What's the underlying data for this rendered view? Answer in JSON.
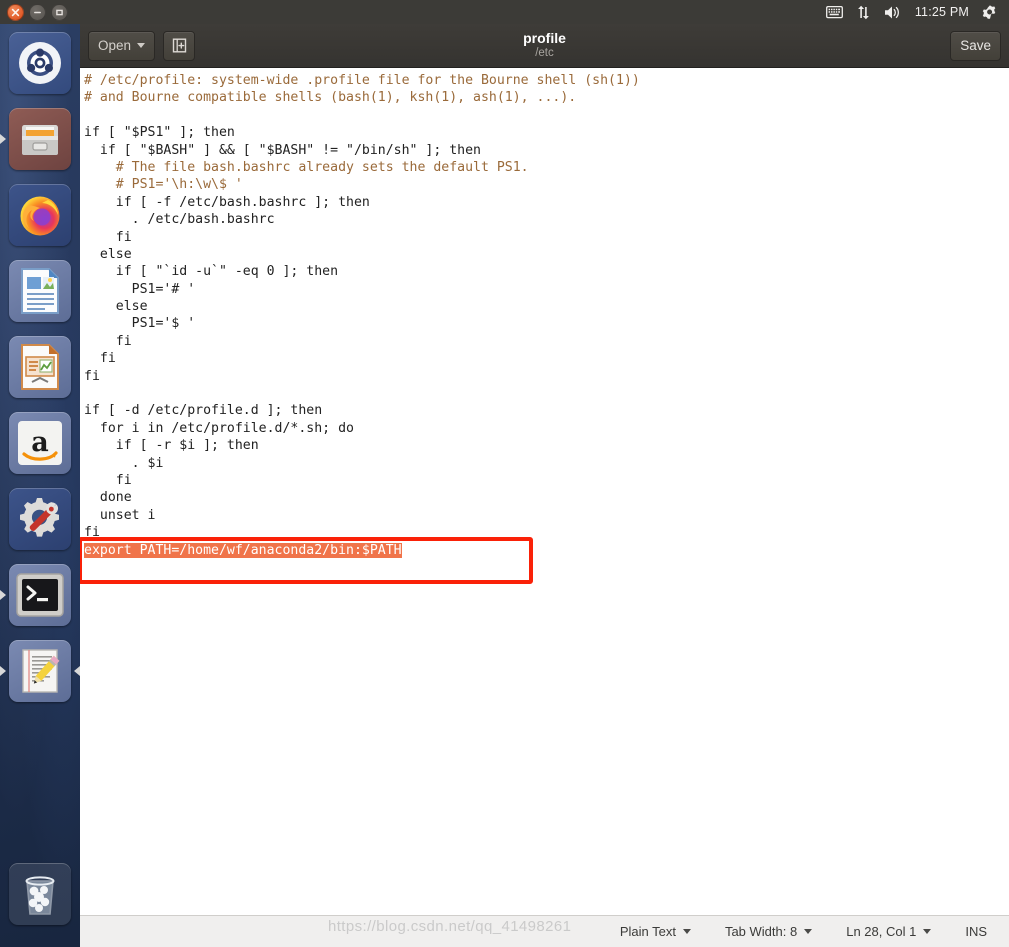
{
  "top_panel": {
    "window_controls": [
      {
        "name": "close",
        "glyph": "×"
      },
      {
        "name": "minimize",
        "glyph": "–"
      },
      {
        "name": "maximize",
        "glyph": "□"
      }
    ],
    "tray": [
      {
        "icon": "keyboard-icon"
      },
      {
        "icon": "network-icon"
      },
      {
        "icon": "volume-icon"
      }
    ],
    "clock": "11:25 PM",
    "settings_icon": "gear-icon"
  },
  "launcher": {
    "items": [
      {
        "label": "Ubuntu Dash",
        "icon": "ubuntu-logo-icon",
        "running": false
      },
      {
        "label": "Files",
        "icon": "file-cabinet-icon",
        "running": true
      },
      {
        "label": "Firefox",
        "icon": "firefox-icon",
        "running": false
      },
      {
        "label": "LibreOffice Writer",
        "icon": "writer-document-icon",
        "running": false
      },
      {
        "label": "LibreOffice Impress",
        "icon": "impress-presentation-icon",
        "running": false
      },
      {
        "label": "Amazon",
        "icon": "amazon-icon",
        "running": false
      },
      {
        "label": "System Settings",
        "icon": "gear-wrench-icon",
        "running": false
      },
      {
        "label": "Terminal",
        "icon": "terminal-icon",
        "running": true
      },
      {
        "label": "Text Editor",
        "icon": "pencil-notepad-icon",
        "running": true
      }
    ],
    "trash": {
      "label": "Trash",
      "icon": "trash-bin-icon"
    }
  },
  "header": {
    "open_label": "Open",
    "open_caret_icon": "chevron-down-icon",
    "new_doc_icon": "new-document-icon",
    "title": "profile",
    "subtitle": "/etc",
    "save_label": "Save"
  },
  "editor": {
    "lines": [
      {
        "text": "# /etc/profile: system-wide .profile file for the Bourne shell (sh(1))",
        "comment": true
      },
      {
        "text": "# and Bourne compatible shells (bash(1), ksh(1), ash(1), ...).",
        "comment": true
      },
      {
        "text": ""
      },
      {
        "text": "if [ \"$PS1\" ]; then"
      },
      {
        "text": "  if [ \"$BASH\" ] && [ \"$BASH\" != \"/bin/sh\" ]; then"
      },
      {
        "text": "    # The file bash.bashrc already sets the default PS1.",
        "comment": true
      },
      {
        "text": "    # PS1='\\h:\\w\\$ '",
        "comment": true
      },
      {
        "text": "    if [ -f /etc/bash.bashrc ]; then"
      },
      {
        "text": "      . /etc/bash.bashrc"
      },
      {
        "text": "    fi"
      },
      {
        "text": "  else"
      },
      {
        "text": "    if [ \"`id -u`\" -eq 0 ]; then"
      },
      {
        "text": "      PS1='# '"
      },
      {
        "text": "    else"
      },
      {
        "text": "      PS1='$ '"
      },
      {
        "text": "    fi"
      },
      {
        "text": "  fi"
      },
      {
        "text": "fi"
      },
      {
        "text": ""
      },
      {
        "text": "if [ -d /etc/profile.d ]; then"
      },
      {
        "text": "  for i in /etc/profile.d/*.sh; do"
      },
      {
        "text": "    if [ -r $i ]; then"
      },
      {
        "text": "      . $i"
      },
      {
        "text": "    fi"
      },
      {
        "text": "  done"
      },
      {
        "text": "  unset i"
      },
      {
        "text": "fi"
      },
      {
        "text": "export PATH=/home/wf/anaconda2/bin:$PATH",
        "selected": true
      },
      {
        "text": ""
      }
    ],
    "selection_color": "#f0744a",
    "annotation_box_color": "#fa2108"
  },
  "statusbar": {
    "language": "Plain Text",
    "tab_width": "Tab Width: 8",
    "cursor_position": "Ln 28, Col 1",
    "insert_mode": "INS",
    "watermark": "https://blog.csdn.net/qq_41498261"
  }
}
